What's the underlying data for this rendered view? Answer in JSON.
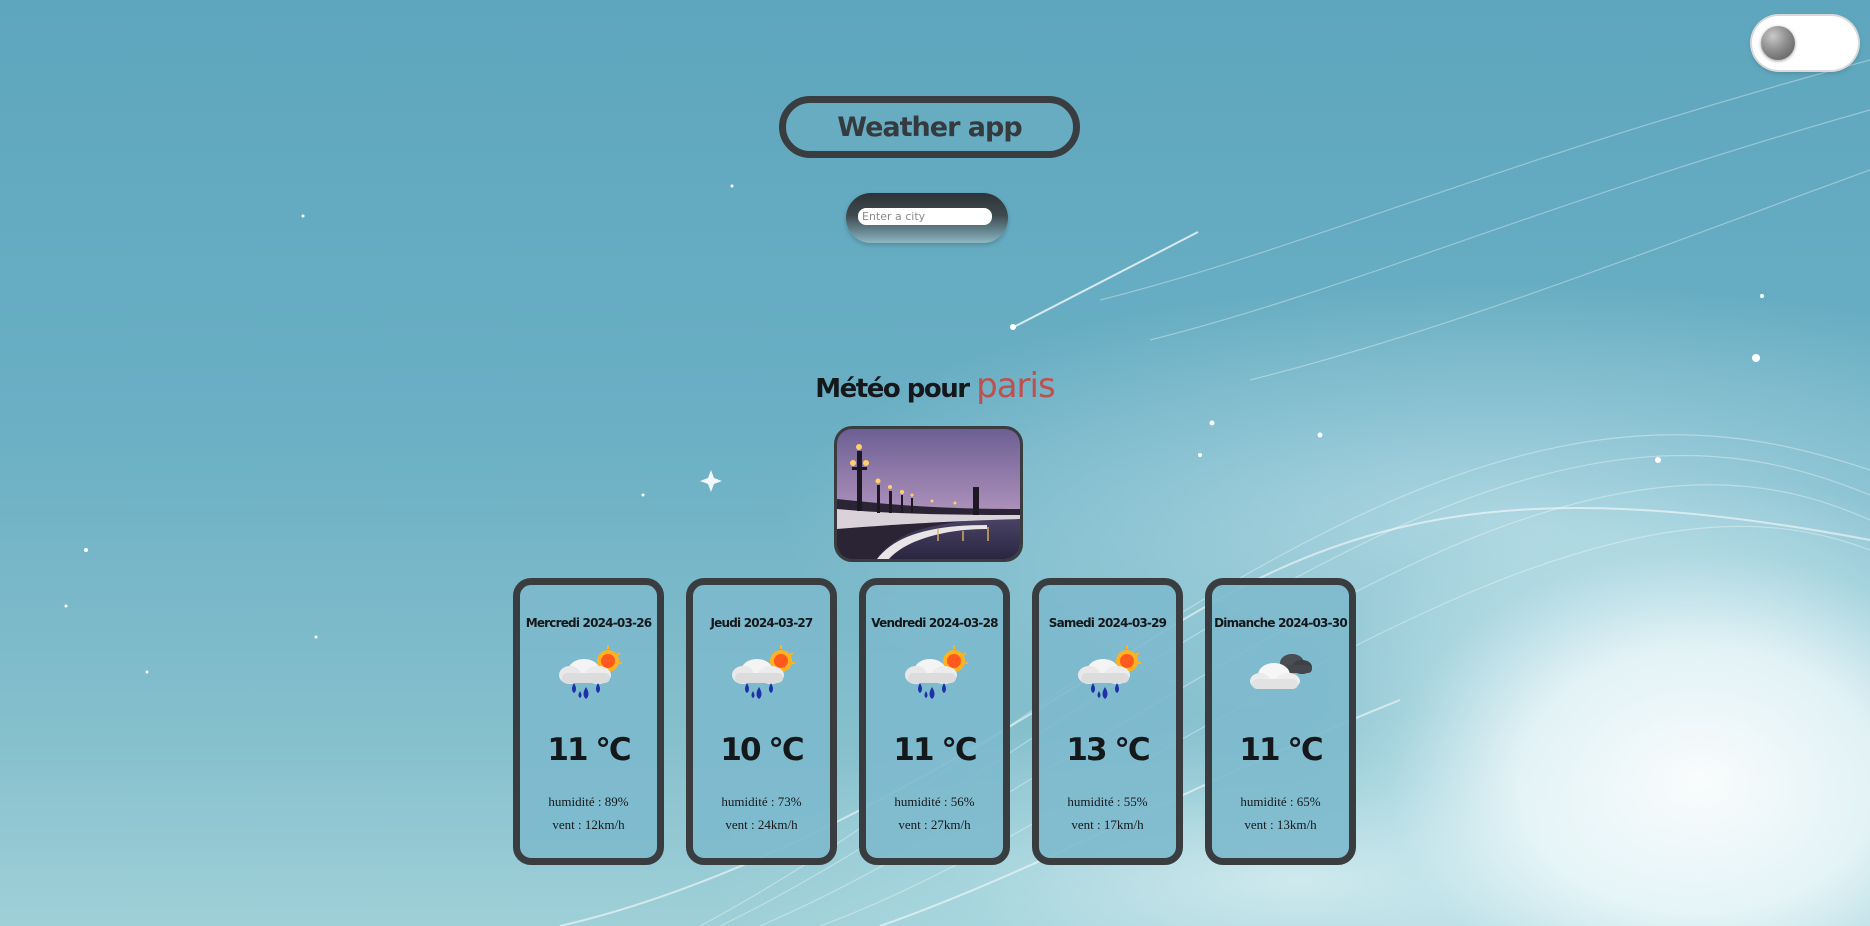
{
  "app": {
    "title": "Weather app"
  },
  "theme_toggle": {
    "state": "off"
  },
  "search": {
    "placeholder": "Enter a city",
    "value": ""
  },
  "location": {
    "prefix": "Météo pour",
    "city": "paris",
    "city_color": "#c0504d"
  },
  "forecast": [
    {
      "date": "Mercredi 2024-03-26",
      "icon": "rain-sun-icon",
      "temp": "11 °C",
      "humidity": "humidité : 89%",
      "wind": "vent : 12km/h"
    },
    {
      "date": "Jeudi 2024-03-27",
      "icon": "rain-sun-icon",
      "temp": "10 °C",
      "humidity": "humidité : 73%",
      "wind": "vent : 24km/h"
    },
    {
      "date": "Vendredi 2024-03-28",
      "icon": "rain-sun-icon",
      "temp": "11 °C",
      "humidity": "humidité : 56%",
      "wind": "vent : 27km/h"
    },
    {
      "date": "Samedi 2024-03-29",
      "icon": "rain-sun-icon",
      "temp": "13 °C",
      "humidity": "humidité : 55%",
      "wind": "vent : 17km/h"
    },
    {
      "date": "Dimanche 2024-03-30",
      "icon": "clouds-icon",
      "temp": "11 °C",
      "humidity": "humidité : 65%",
      "wind": "vent : 13km/h"
    }
  ],
  "colors": {
    "card_border": "#3a3d40",
    "text": "#15181a"
  }
}
